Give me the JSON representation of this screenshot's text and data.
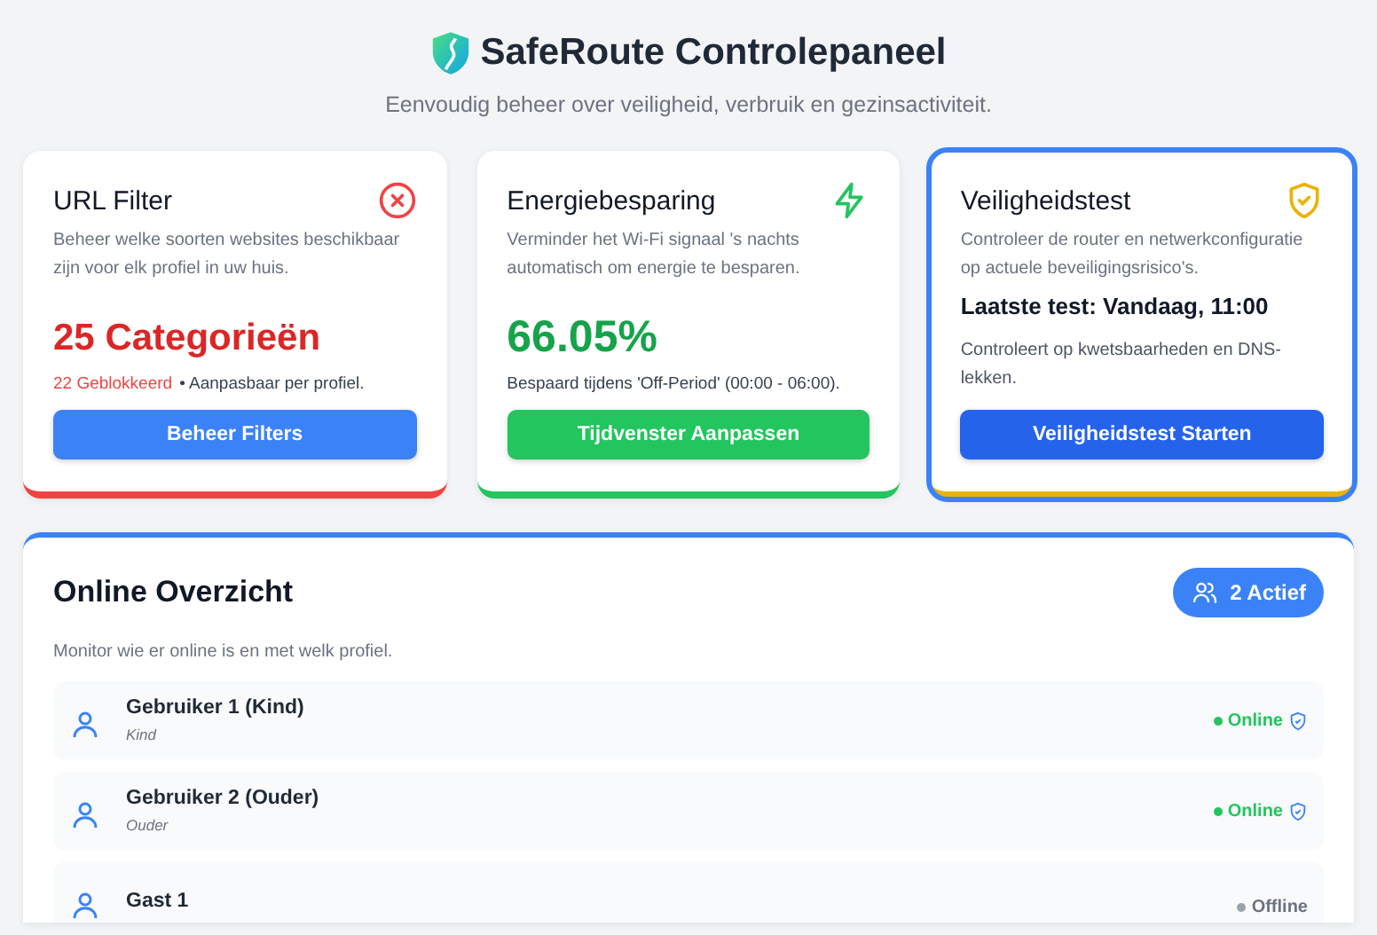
{
  "header": {
    "title": "SafeRoute Controlepaneel",
    "subtitle": "Eenvoudig beheer over veiligheid, verbruik en gezinsactiviteit."
  },
  "cards": [
    {
      "kind": "filter",
      "title": "URL Filter",
      "description": "Beheer welke soorten websites beschikbaar zijn voor elk profiel in uw huis.",
      "color": "#ef4444",
      "highlighted": false,
      "value": "25 Categorieën",
      "note_emphasis": "22 Geblokkeerd",
      "note": "• Aanpasbaar per profiel.",
      "button": "Beheer Filters"
    },
    {
      "kind": "energy",
      "title": "Energiebesparing",
      "description": "Verminder het Wi-Fi signaal 's nachts automatisch om energie te besparen.",
      "color": "#22c55e",
      "highlighted": false,
      "value": "66.05%",
      "note": "Bespaard tijdens 'Off-Period' (00:00 - 06:00).",
      "button": "Tijdvenster Aanpassen"
    },
    {
      "kind": "security",
      "title": "Veiligheidstest",
      "description": "Controleer de router en netwerkconfiguratie op actuele beveiligingsrisico's.",
      "color": "#eab308",
      "highlighted": true,
      "value": "Laatste test: Vandaag, 11:00",
      "note": "Controleert op kwetsbaarheden en DNS-lekken.",
      "button": "Veiligheidstest Starten"
    }
  ],
  "online": {
    "title": "Online Overzicht",
    "badge": "2 Actief",
    "description": "Monitor wie er online is en met welk profiel.",
    "users": [
      {
        "name": "Gebruiker 1 (Kind)",
        "profile": "Kind",
        "online": true,
        "status_label": "Online"
      },
      {
        "name": "Gebruiker 2 (Ouder)",
        "profile": "Ouder",
        "online": true,
        "status_label": "Online"
      },
      {
        "name": "Gast 1",
        "online": false,
        "status_label": "Offline"
      }
    ]
  }
}
